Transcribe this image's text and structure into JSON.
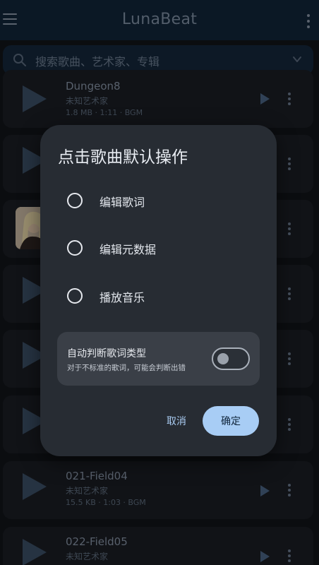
{
  "app_bar": {
    "title": "LunaBeat",
    "menu_icon": "hamburger-menu-icon",
    "more_icon": "more-vertical-icon"
  },
  "search": {
    "placeholder": "搜索歌曲、艺术家、专辑",
    "icon": "search-icon",
    "chevron_icon": "chevron-down-icon"
  },
  "songs": [
    {
      "title": "Dungeon8",
      "artist": "未知艺术家",
      "meta": "1.8 MB · 1:11 · BGM"
    },
    {
      "title": "",
      "artist": "",
      "meta": ""
    },
    {
      "title": "",
      "artist": "",
      "meta": ""
    },
    {
      "title": "",
      "artist": "",
      "meta": ""
    },
    {
      "title": "",
      "artist": "",
      "meta": ""
    },
    {
      "title": "",
      "artist": "",
      "meta": ""
    },
    {
      "title": "021-Field04",
      "artist": "未知艺术家",
      "meta": "15.5 KB · 1:03 · BGM"
    },
    {
      "title": "022-Field05",
      "artist": "未知艺术家",
      "meta": ""
    }
  ],
  "dialog": {
    "title": "点击歌曲默认操作",
    "options": [
      "编辑歌词",
      "编辑元数据",
      "播放音乐"
    ],
    "auto_detect": {
      "title": "自动判断歌词类型",
      "subtitle": "对于不标准的歌词，可能会判断出错",
      "enabled": false
    },
    "cancel_label": "取消",
    "ok_label": "确定"
  },
  "colors": {
    "accent": "#a8cdf5",
    "app_bar": "#12253a",
    "dialog_bg": "#272c33"
  }
}
